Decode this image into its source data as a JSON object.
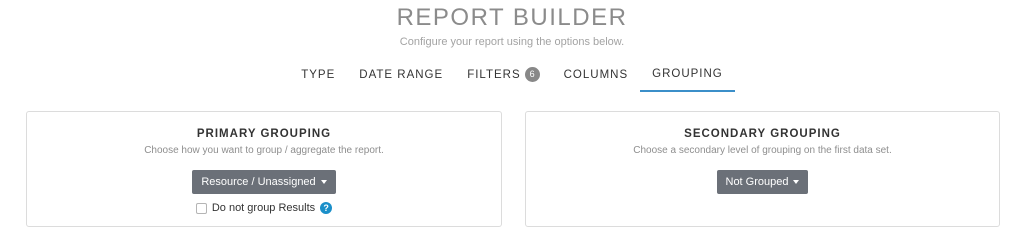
{
  "header": {
    "title": "REPORT BUILDER",
    "subtitle": "Configure your report using the options below."
  },
  "tabs": [
    {
      "label": "TYPE",
      "active": false
    },
    {
      "label": "DATE RANGE",
      "active": false
    },
    {
      "label": "FILTERS",
      "badge": "6",
      "active": false
    },
    {
      "label": "COLUMNS",
      "active": false
    },
    {
      "label": "GROUPING",
      "active": true
    }
  ],
  "primary": {
    "title": "PRIMARY GROUPING",
    "description": "Choose how you want to group / aggregate the report.",
    "dropdown_value": "Resource / Unassigned",
    "checkbox_label": "Do not group Results",
    "checkbox_checked": false,
    "help_glyph": "?"
  },
  "secondary": {
    "title": "SECONDARY GROUPING",
    "description": "Choose a secondary level of grouping on the first data set.",
    "dropdown_value": "Not Grouped"
  },
  "colors": {
    "accent": "#3b8fc9",
    "button": "#6b7078",
    "help": "#1a8fc9",
    "title": "#8b8b8b"
  }
}
